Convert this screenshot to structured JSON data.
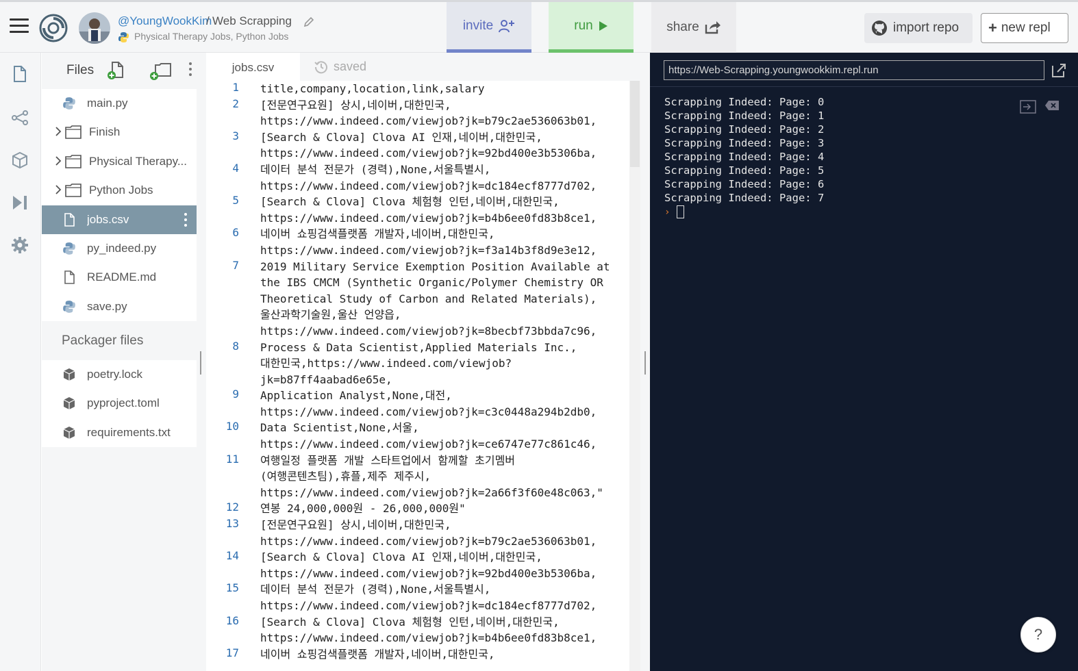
{
  "topbar": {
    "owner": "@YoungWookKim",
    "separator": "/",
    "repl_name": "Web Scrapping",
    "description": "Physical Therapy Jobs, Python Jobs",
    "invite_label": "invite",
    "run_label": "run",
    "share_label": "share",
    "import_label": "import repo",
    "new_label": "new repl"
  },
  "files": {
    "title": "Files",
    "items": [
      {
        "name": "main.py",
        "type": "python"
      },
      {
        "name": "Finish",
        "type": "folder"
      },
      {
        "name": "Physical Therapy...",
        "type": "folder"
      },
      {
        "name": "Python Jobs",
        "type": "folder"
      },
      {
        "name": "jobs.csv",
        "type": "file",
        "selected": true
      },
      {
        "name": "py_indeed.py",
        "type": "python"
      },
      {
        "name": "README.md",
        "type": "file"
      },
      {
        "name": "save.py",
        "type": "python"
      }
    ],
    "packager_title": "Packager files",
    "packager_items": [
      {
        "name": "poetry.lock"
      },
      {
        "name": "pyproject.toml"
      },
      {
        "name": "requirements.txt"
      }
    ]
  },
  "editor": {
    "tab": "jobs.csv",
    "status": "saved",
    "lines": [
      {
        "n": "1",
        "text": "title,company,location,link,salary"
      },
      {
        "n": "2",
        "text": "[전문연구요원] 상시,네이버,대한민국,\nhttps://www.indeed.com/viewjob?jk=b79c2ae536063b01,"
      },
      {
        "n": "3",
        "text": "[Search & Clova] Clova AI 인재,네이버,대한민국,\nhttps://www.indeed.com/viewjob?jk=92bd400e3b5306ba,"
      },
      {
        "n": "4",
        "text": "데이터 분석 전문가 (경력),None,서울특별시,\nhttps://www.indeed.com/viewjob?jk=dc184ecf8777d702,"
      },
      {
        "n": "5",
        "text": "[Search & Clova] Clova 체험형 인턴,네이버,대한민국,\nhttps://www.indeed.com/viewjob?jk=b4b6ee0fd83b8ce1,"
      },
      {
        "n": "6",
        "text": "네이버 쇼핑검색플랫폼 개발자,네이버,대한민국,\nhttps://www.indeed.com/viewjob?jk=f3a14b3f8d9e3e12,"
      },
      {
        "n": "7",
        "text": "2019 Military Service Exemption Position Available at\nthe IBS CMCM (Synthetic Organic/Polymer Chemistry OR\nTheoretical Study of Carbon and Related Materials),\n울산과학기술원,울산 언양읍,\nhttps://www.indeed.com/viewjob?jk=8becbf73bbda7c96,"
      },
      {
        "n": "8",
        "text": "Process & Data Scientist,Applied Materials Inc.,\n대한민국,https://www.indeed.com/viewjob?\njk=b87ff4aabad6e65e,"
      },
      {
        "n": "9",
        "text": "Application Analyst,None,대전,\nhttps://www.indeed.com/viewjob?jk=c3c0448a294b2db0,"
      },
      {
        "n": "10",
        "text": "Data Scientist,None,서울,\nhttps://www.indeed.com/viewjob?jk=ce6747e77c861c46,"
      },
      {
        "n": "11",
        "text": "여행일정 플랫폼 개발 스타트업에서 함께할 초기멤버\n(여행콘텐츠팀),휴플,제주 제주시,\nhttps://www.indeed.com/viewjob?jk=2a66f3f60e48c063,\""
      },
      {
        "n": "12",
        "text": "연봉 24,000,000원 - 26,000,000원\""
      },
      {
        "n": "13",
        "text": "[전문연구요원] 상시,네이버,대한민국,\nhttps://www.indeed.com/viewjob?jk=b79c2ae536063b01,"
      },
      {
        "n": "14",
        "text": "[Search & Clova] Clova AI 인재,네이버,대한민국,\nhttps://www.indeed.com/viewjob?jk=92bd400e3b5306ba,"
      },
      {
        "n": "15",
        "text": "데이터 분석 전문가 (경력),None,서울특별시,\nhttps://www.indeed.com/viewjob?jk=dc184ecf8777d702,"
      },
      {
        "n": "16",
        "text": "[Search & Clova] Clova 체험형 인턴,네이버,대한민국,\nhttps://www.indeed.com/viewjob?jk=b4b6ee0fd83b8ce1,"
      },
      {
        "n": "17",
        "text": "네이버 쇼핑검색플랫폼 개발자,네이버,대한민국,"
      }
    ]
  },
  "console": {
    "url": "https://Web-Scrapping.youngwookkim.repl.run",
    "output": [
      "Scrapping Indeed: Page: 0",
      "Scrapping Indeed: Page: 1",
      "Scrapping Indeed: Page: 2",
      "Scrapping Indeed: Page: 3",
      "Scrapping Indeed: Page: 4",
      "Scrapping Indeed: Page: 5",
      "Scrapping Indeed: Page: 6",
      "Scrapping Indeed: Page: 7"
    ],
    "prompt": "›"
  },
  "help_label": "?"
}
